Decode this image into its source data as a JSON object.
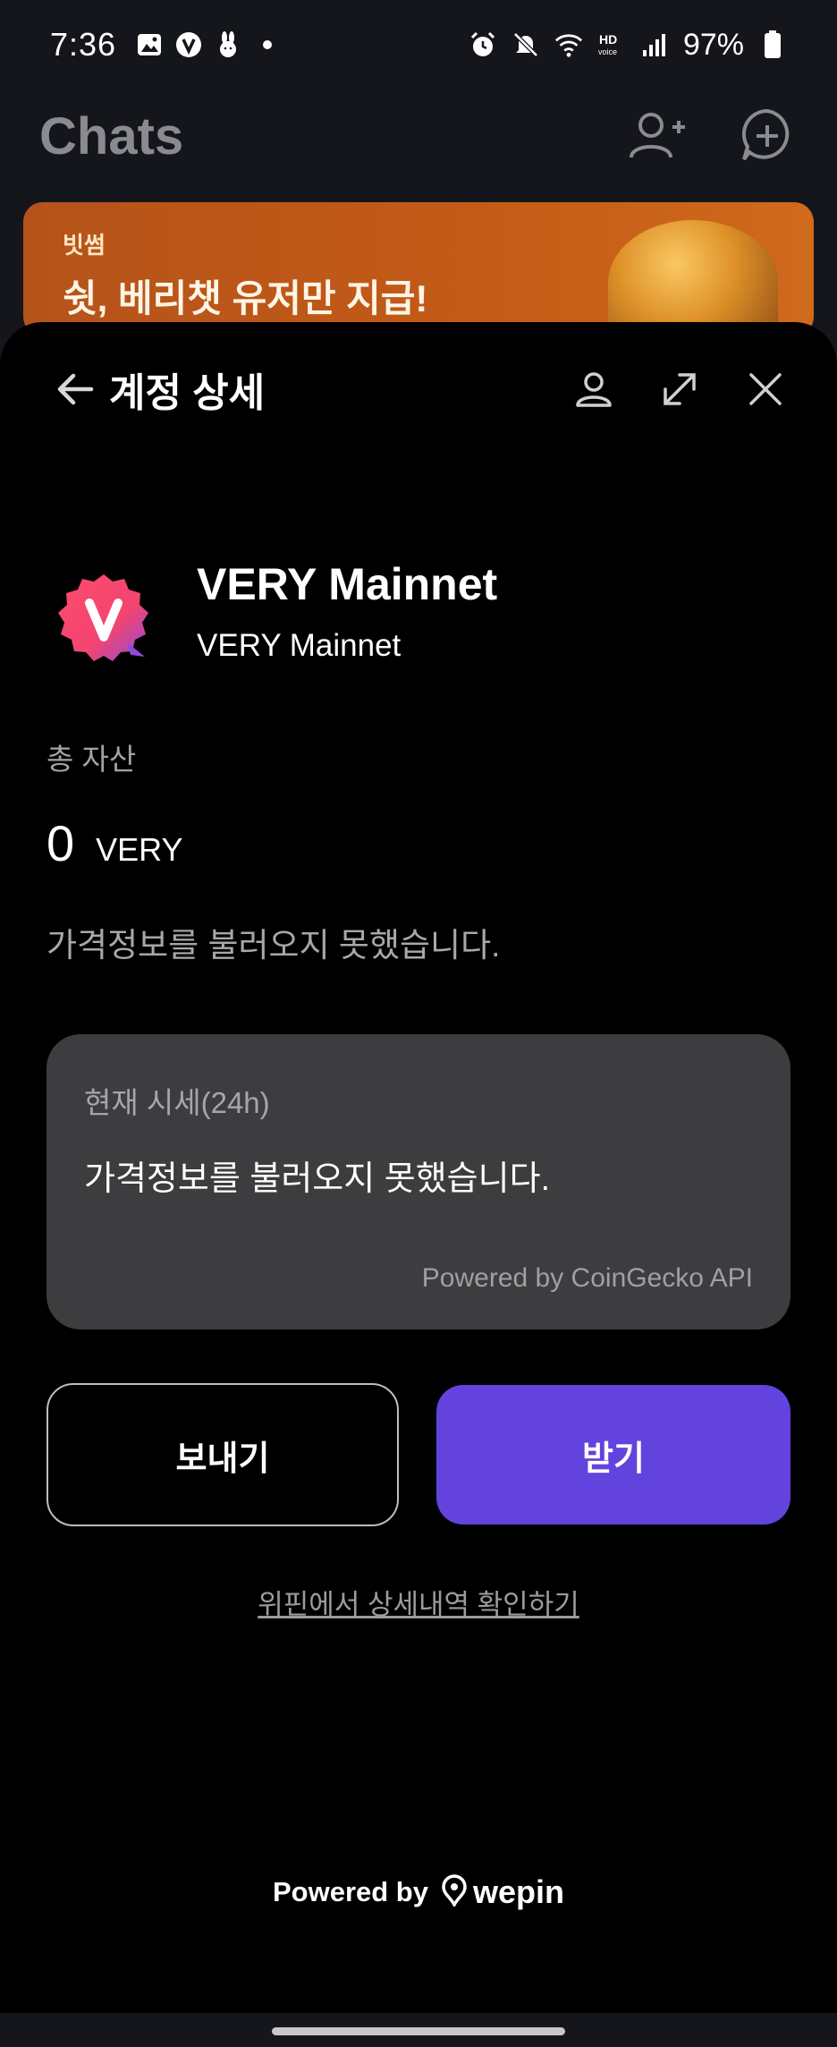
{
  "status_bar": {
    "time": "7:36",
    "battery_percent": "97%",
    "icons_left": [
      "gallery-icon",
      "very-app-icon",
      "bunny-icon",
      "dot-icon"
    ],
    "icons_right": [
      "alarm-icon",
      "mute-icon",
      "wifi-icon",
      "hd-voice-icon",
      "signal-icon",
      "battery-icon"
    ]
  },
  "chats_header": {
    "title": "Chats",
    "icons": [
      "add-friend-icon",
      "new-chat-icon"
    ]
  },
  "banner": {
    "brand": "빗썸",
    "headline": "쉿, 베리챗 유저만 지급!"
  },
  "sheet": {
    "title": "계정 상세",
    "token": {
      "name": "VERY Mainnet",
      "network": "VERY Mainnet",
      "logo_letter": "V"
    },
    "total_assets_label": "총 자산",
    "balance": {
      "amount": "0",
      "unit": "VERY"
    },
    "price_error": "가격정보를 불러오지 못했습니다.",
    "price_card": {
      "label": "현재 시세(24h)",
      "message": "가격정보를 불러오지 못했습니다.",
      "powered_by": "Powered by CoinGecko API"
    },
    "send_label": "보내기",
    "receive_label": "받기",
    "detail_link": "위핀에서 상세내역 확인하기",
    "footer": {
      "powered_by": "Powered by",
      "brand": "wepin"
    }
  },
  "colors": {
    "accent": "#6243dd",
    "sheet_bg": "#000000",
    "card_bg": "#3d3d40",
    "app_bg": "#15161b"
  }
}
